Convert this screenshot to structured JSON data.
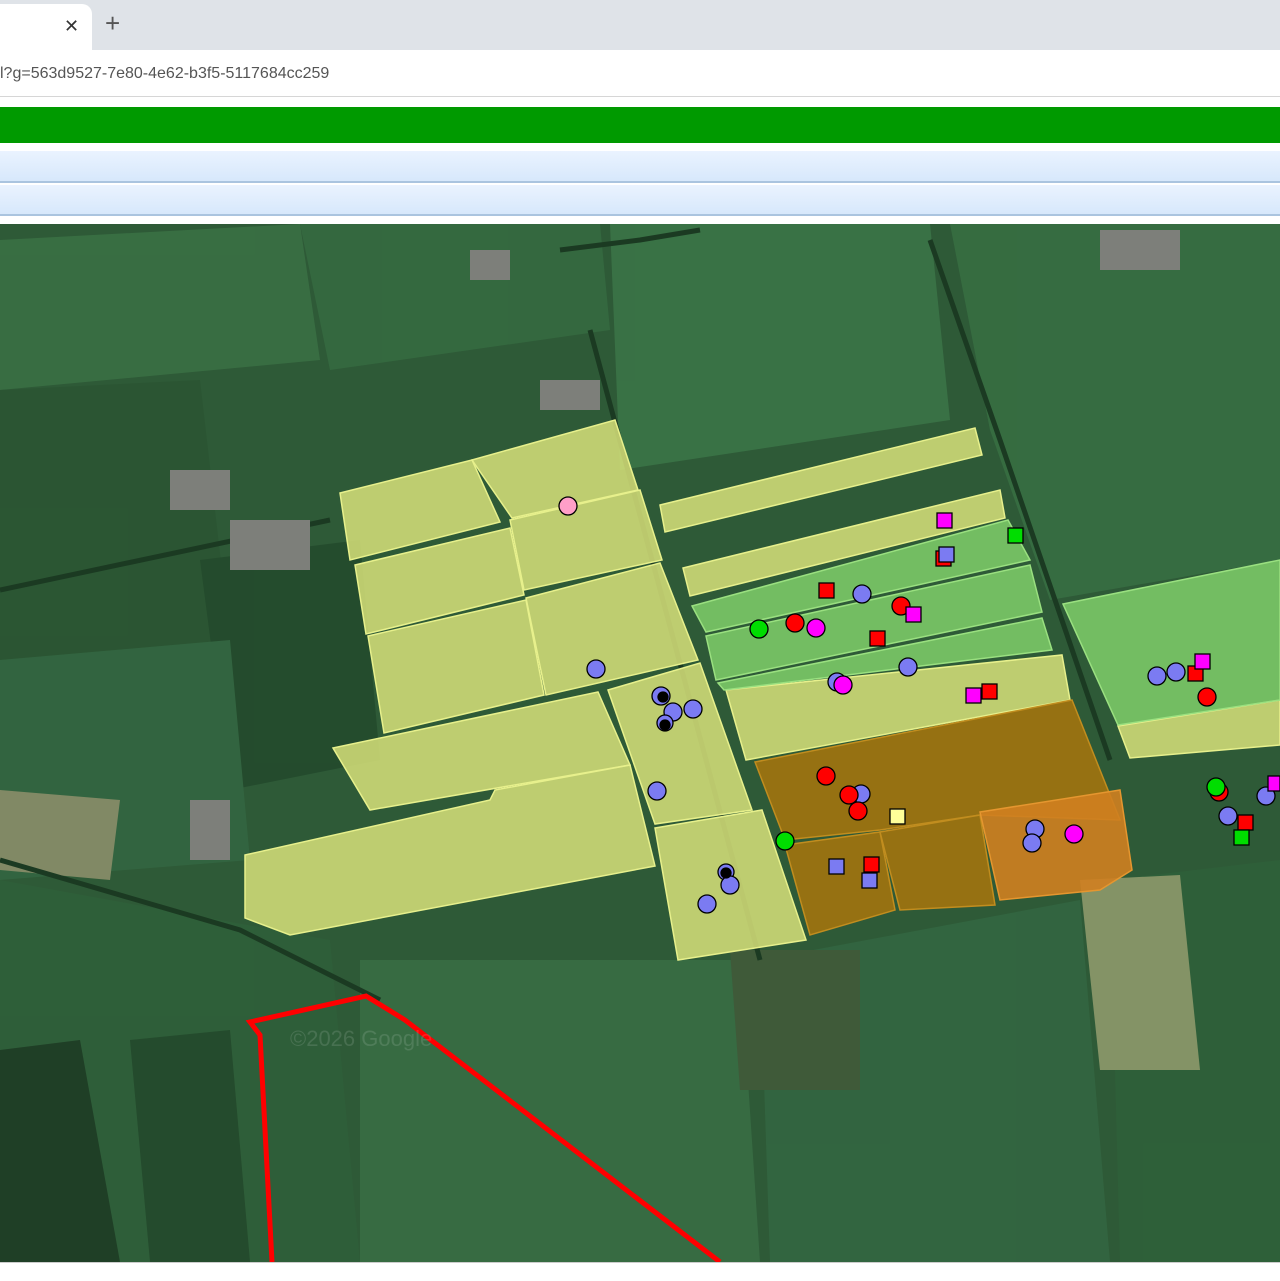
{
  "browser": {
    "close_glyph": "✕",
    "newtab_glyph": "+",
    "url": "l?g=563d9527-7e80-4e62-b3f5-5117684cc259"
  },
  "colors": {
    "header_green": "#009a00",
    "boundary_red": "#ff0000",
    "marker_blue": "#7b7bf2",
    "marker_red": "#ff0000",
    "marker_green": "#00dd00",
    "marker_magenta": "#ff00ff",
    "marker_pink": "#ff9fc8",
    "marker_yellow": "#ffff99"
  },
  "map": {
    "watermark": "©2026 Google",
    "field_layers": [
      "light-yellow-fields",
      "green-fields",
      "brown-fields",
      "orange-field"
    ],
    "marker_counts": {
      "blue_circle": 23,
      "red_circle": 7,
      "green_circle": 3,
      "magenta_circle": 3,
      "pink_circle": 1,
      "red_square": 7,
      "magenta_square": 5,
      "blue_square": 3,
      "green_square": 2,
      "yellow_square": 1
    }
  }
}
